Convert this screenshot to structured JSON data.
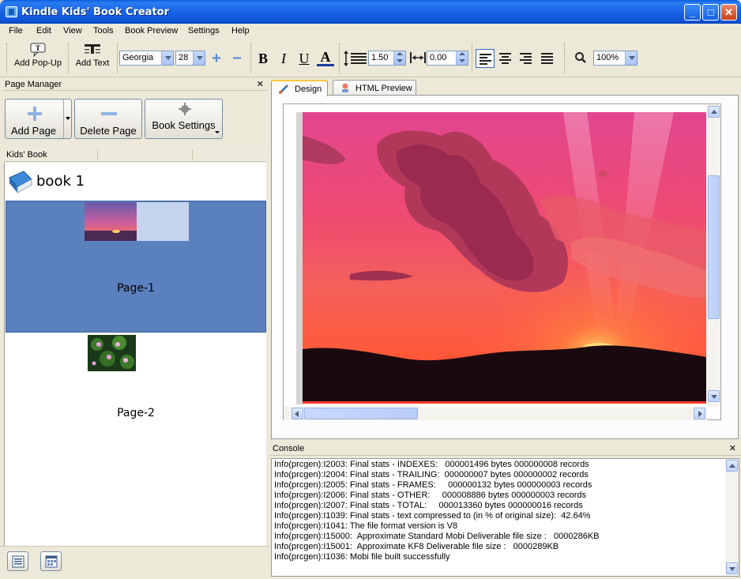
{
  "window": {
    "title": "Kindle Kids' Book Creator"
  },
  "menu": [
    "File",
    "Edit",
    "View",
    "Tools",
    "Book Preview",
    "Settings",
    "Help"
  ],
  "toolbar": {
    "add_popup": "Add Pop-Up",
    "add_text": "Add Text",
    "font": "Georgia",
    "font_size": "28",
    "line_spacing": "1.50",
    "char_spacing": "0.00",
    "zoom": "100%",
    "bold": "B",
    "italic": "I",
    "underline": "U",
    "font_color": "A"
  },
  "page_manager": {
    "title": "Page Manager",
    "add_page": "Add Page",
    "delete_page": "Delete Page",
    "book_settings": "Book Settings",
    "column_header": "Kids' Book",
    "book_name": "book 1",
    "pages": [
      {
        "label": "Page-1",
        "selected": true
      },
      {
        "label": "Page-2",
        "selected": false
      }
    ]
  },
  "editor": {
    "tabs": [
      {
        "label": "Design",
        "active": true
      },
      {
        "label": "HTML Preview",
        "active": false
      }
    ]
  },
  "console": {
    "title": "Console",
    "lines": [
      "Info(prcgen):I2003: Final stats - INDEXES:   000001496 bytes 000000008 records",
      "Info(prcgen):I2004: Final stats - TRAILING:  000000007 bytes 000000002 records",
      "Info(prcgen):I2005: Final stats - FRAMES:     000000132 bytes 000000003 records",
      "Info(prcgen):I2006: Final stats - OTHER:     000008886 bytes 000000003 records",
      "Info(prcgen):I2007: Final stats - TOTAL:     000013360 bytes 000000016 records",
      "Info(prcgen):I1039: Final stats - text compressed to (in % of original size):  42.64%",
      "Info(prcgen):I1041: The file format version is V8",
      "Info(prcgen):I15000:  Approximate Standard Mobi Deliverable file size :   0000286KB",
      "Info(prcgen):I15001:  Approximate KF8 Deliverable file size :   0000289KB",
      "Info(prcgen):I1036: Mobi file built successfully"
    ]
  },
  "colors": {
    "titlebar": "#0a5fdf",
    "selection": "#5b80be",
    "tab_highlight": "#ffc83c"
  }
}
